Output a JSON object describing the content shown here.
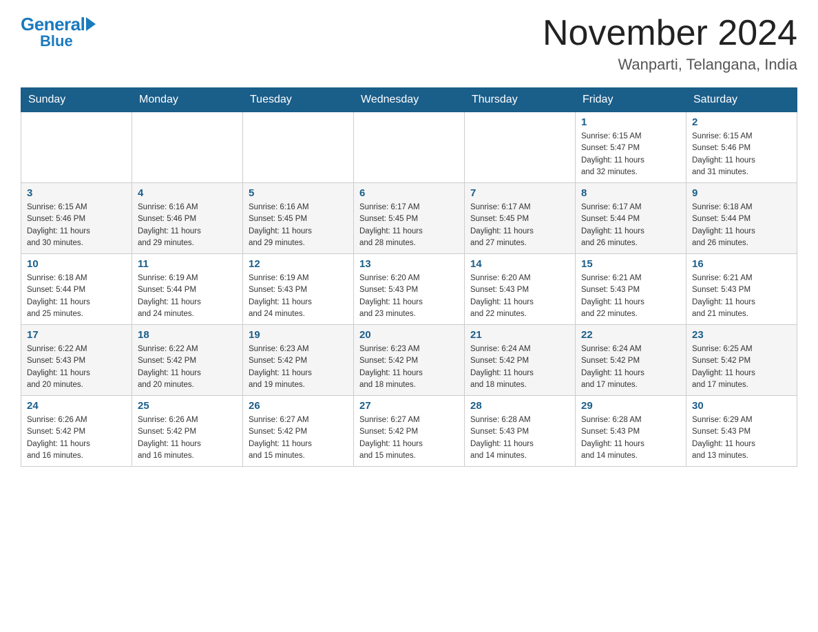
{
  "logo": {
    "general": "General",
    "blue": "Blue"
  },
  "header": {
    "month_year": "November 2024",
    "location": "Wanparti, Telangana, India"
  },
  "weekdays": [
    "Sunday",
    "Monday",
    "Tuesday",
    "Wednesday",
    "Thursday",
    "Friday",
    "Saturday"
  ],
  "weeks": [
    [
      {
        "day": "",
        "info": ""
      },
      {
        "day": "",
        "info": ""
      },
      {
        "day": "",
        "info": ""
      },
      {
        "day": "",
        "info": ""
      },
      {
        "day": "",
        "info": ""
      },
      {
        "day": "1",
        "info": "Sunrise: 6:15 AM\nSunset: 5:47 PM\nDaylight: 11 hours\nand 32 minutes."
      },
      {
        "day": "2",
        "info": "Sunrise: 6:15 AM\nSunset: 5:46 PM\nDaylight: 11 hours\nand 31 minutes."
      }
    ],
    [
      {
        "day": "3",
        "info": "Sunrise: 6:15 AM\nSunset: 5:46 PM\nDaylight: 11 hours\nand 30 minutes."
      },
      {
        "day": "4",
        "info": "Sunrise: 6:16 AM\nSunset: 5:46 PM\nDaylight: 11 hours\nand 29 minutes."
      },
      {
        "day": "5",
        "info": "Sunrise: 6:16 AM\nSunset: 5:45 PM\nDaylight: 11 hours\nand 29 minutes."
      },
      {
        "day": "6",
        "info": "Sunrise: 6:17 AM\nSunset: 5:45 PM\nDaylight: 11 hours\nand 28 minutes."
      },
      {
        "day": "7",
        "info": "Sunrise: 6:17 AM\nSunset: 5:45 PM\nDaylight: 11 hours\nand 27 minutes."
      },
      {
        "day": "8",
        "info": "Sunrise: 6:17 AM\nSunset: 5:44 PM\nDaylight: 11 hours\nand 26 minutes."
      },
      {
        "day": "9",
        "info": "Sunrise: 6:18 AM\nSunset: 5:44 PM\nDaylight: 11 hours\nand 26 minutes."
      }
    ],
    [
      {
        "day": "10",
        "info": "Sunrise: 6:18 AM\nSunset: 5:44 PM\nDaylight: 11 hours\nand 25 minutes."
      },
      {
        "day": "11",
        "info": "Sunrise: 6:19 AM\nSunset: 5:44 PM\nDaylight: 11 hours\nand 24 minutes."
      },
      {
        "day": "12",
        "info": "Sunrise: 6:19 AM\nSunset: 5:43 PM\nDaylight: 11 hours\nand 24 minutes."
      },
      {
        "day": "13",
        "info": "Sunrise: 6:20 AM\nSunset: 5:43 PM\nDaylight: 11 hours\nand 23 minutes."
      },
      {
        "day": "14",
        "info": "Sunrise: 6:20 AM\nSunset: 5:43 PM\nDaylight: 11 hours\nand 22 minutes."
      },
      {
        "day": "15",
        "info": "Sunrise: 6:21 AM\nSunset: 5:43 PM\nDaylight: 11 hours\nand 22 minutes."
      },
      {
        "day": "16",
        "info": "Sunrise: 6:21 AM\nSunset: 5:43 PM\nDaylight: 11 hours\nand 21 minutes."
      }
    ],
    [
      {
        "day": "17",
        "info": "Sunrise: 6:22 AM\nSunset: 5:43 PM\nDaylight: 11 hours\nand 20 minutes."
      },
      {
        "day": "18",
        "info": "Sunrise: 6:22 AM\nSunset: 5:42 PM\nDaylight: 11 hours\nand 20 minutes."
      },
      {
        "day": "19",
        "info": "Sunrise: 6:23 AM\nSunset: 5:42 PM\nDaylight: 11 hours\nand 19 minutes."
      },
      {
        "day": "20",
        "info": "Sunrise: 6:23 AM\nSunset: 5:42 PM\nDaylight: 11 hours\nand 18 minutes."
      },
      {
        "day": "21",
        "info": "Sunrise: 6:24 AM\nSunset: 5:42 PM\nDaylight: 11 hours\nand 18 minutes."
      },
      {
        "day": "22",
        "info": "Sunrise: 6:24 AM\nSunset: 5:42 PM\nDaylight: 11 hours\nand 17 minutes."
      },
      {
        "day": "23",
        "info": "Sunrise: 6:25 AM\nSunset: 5:42 PM\nDaylight: 11 hours\nand 17 minutes."
      }
    ],
    [
      {
        "day": "24",
        "info": "Sunrise: 6:26 AM\nSunset: 5:42 PM\nDaylight: 11 hours\nand 16 minutes."
      },
      {
        "day": "25",
        "info": "Sunrise: 6:26 AM\nSunset: 5:42 PM\nDaylight: 11 hours\nand 16 minutes."
      },
      {
        "day": "26",
        "info": "Sunrise: 6:27 AM\nSunset: 5:42 PM\nDaylight: 11 hours\nand 15 minutes."
      },
      {
        "day": "27",
        "info": "Sunrise: 6:27 AM\nSunset: 5:42 PM\nDaylight: 11 hours\nand 15 minutes."
      },
      {
        "day": "28",
        "info": "Sunrise: 6:28 AM\nSunset: 5:43 PM\nDaylight: 11 hours\nand 14 minutes."
      },
      {
        "day": "29",
        "info": "Sunrise: 6:28 AM\nSunset: 5:43 PM\nDaylight: 11 hours\nand 14 minutes."
      },
      {
        "day": "30",
        "info": "Sunrise: 6:29 AM\nSunset: 5:43 PM\nDaylight: 11 hours\nand 13 minutes."
      }
    ]
  ]
}
